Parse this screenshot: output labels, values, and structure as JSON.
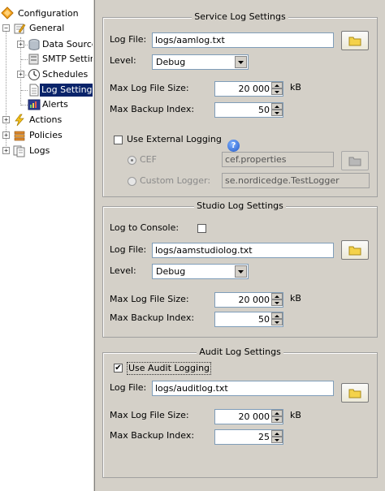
{
  "tree": {
    "root": "Configuration",
    "general": "General",
    "data_sources": "Data Sources",
    "smtp_settings": "SMTP Settings",
    "schedules": "Schedules",
    "log_settings": "Log Settings",
    "alerts": "Alerts",
    "actions": "Actions",
    "policies": "Policies",
    "logs": "Logs"
  },
  "service": {
    "title": "Service Log Settings",
    "log_file_label": "Log File:",
    "log_file_value": "logs/aamlog.txt",
    "level_label": "Level:",
    "level_value": "Debug",
    "max_size_label": "Max Log File Size:",
    "max_size_value": "20 000",
    "max_size_unit": "kB",
    "max_backup_label": "Max Backup Index:",
    "max_backup_value": "50",
    "use_external_label": "Use External Logging",
    "use_external_checked": false,
    "cef_label": "CEF",
    "cef_value": "cef.properties",
    "custom_label": "Custom Logger:",
    "custom_value": "se.nordicedge.TestLogger"
  },
  "studio": {
    "title": "Studio Log Settings",
    "console_label": "Log to Console:",
    "console_checked": false,
    "log_file_label": "Log File:",
    "log_file_value": "logs/aamstudiolog.txt",
    "level_label": "Level:",
    "level_value": "Debug",
    "max_size_label": "Max Log File Size:",
    "max_size_value": "20 000",
    "max_size_unit": "kB",
    "max_backup_label": "Max Backup Index:",
    "max_backup_value": "50"
  },
  "audit": {
    "title": "Audit Log Settings",
    "use_audit_label": "Use Audit Logging",
    "use_audit_checked": true,
    "check_mark": "✔",
    "log_file_label": "Log File:",
    "log_file_value": "logs/auditlog.txt",
    "max_size_label": "Max Log File Size:",
    "max_size_value": "20 000",
    "max_size_unit": "kB",
    "max_backup_label": "Max Backup Index:",
    "max_backup_value": "25"
  },
  "icons": {
    "folder": "folder-icon",
    "help": "help-icon",
    "help_glyph": "?"
  },
  "colors": {
    "panel": "#d4d0c8",
    "selection": "#0a246a",
    "folder": "#f4d24a"
  }
}
